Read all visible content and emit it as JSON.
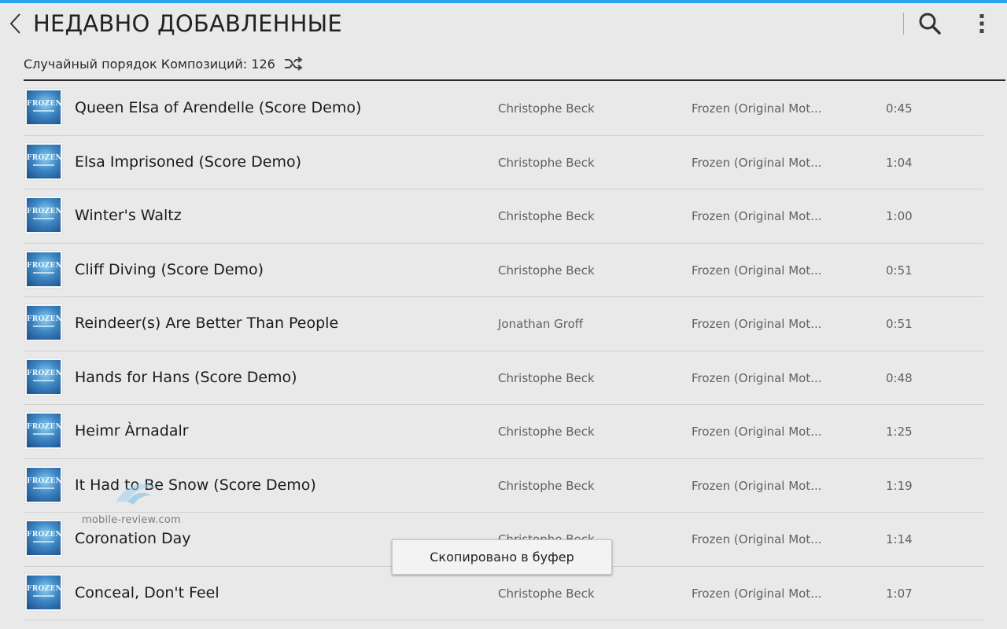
{
  "header": {
    "title": "НЕДАВНО ДОБАВЛЕННЫЕ"
  },
  "subheader": {
    "shuffle_label": "Случайный порядок Композиций: 126"
  },
  "album_art_text": "FROZEN",
  "tracks": [
    {
      "title": "Queen Elsa of Arendelle (Score Demo)",
      "artist": "Christophe Beck",
      "album": "Frozen (Original Mot...",
      "duration": "0:45"
    },
    {
      "title": "Elsa Imprisoned (Score Demo)",
      "artist": "Christophe Beck",
      "album": "Frozen (Original Mot...",
      "duration": "1:04"
    },
    {
      "title": "Winter's Waltz",
      "artist": "Christophe Beck",
      "album": "Frozen (Original Mot...",
      "duration": "1:00"
    },
    {
      "title": "Cliff Diving (Score Demo)",
      "artist": "Christophe Beck",
      "album": "Frozen (Original Mot...",
      "duration": "0:51"
    },
    {
      "title": "Reindeer(s) Are Better Than People",
      "artist": "Jonathan Groff",
      "album": "Frozen (Original Mot...",
      "duration": "0:51"
    },
    {
      "title": "Hands for Hans (Score Demo)",
      "artist": "Christophe Beck",
      "album": "Frozen (Original Mot...",
      "duration": "0:48"
    },
    {
      "title": "Heimr Àrnadalr",
      "artist": "Christophe Beck",
      "album": "Frozen (Original Mot...",
      "duration": "1:25"
    },
    {
      "title": "It Had to Be Snow (Score Demo)",
      "artist": "Christophe Beck",
      "album": "Frozen (Original Mot...",
      "duration": "1:19"
    },
    {
      "title": "Coronation Day",
      "artist": "Christophe Beck",
      "album": "Frozen (Original Mot...",
      "duration": "1:14"
    },
    {
      "title": "Conceal, Don't Feel",
      "artist": "Christophe Beck",
      "album": "Frozen (Original Mot...",
      "duration": "1:07"
    }
  ],
  "watermark": "mobile-review.com",
  "toast": {
    "message": "Скопировано в буфер"
  },
  "colors": {
    "accent": "#29a3f0",
    "background": "#e9e9e9"
  },
  "icons": {
    "back": "chevron-left-icon",
    "search": "search-icon",
    "menu": "more-vert-icon",
    "shuffle": "shuffle-icon"
  }
}
